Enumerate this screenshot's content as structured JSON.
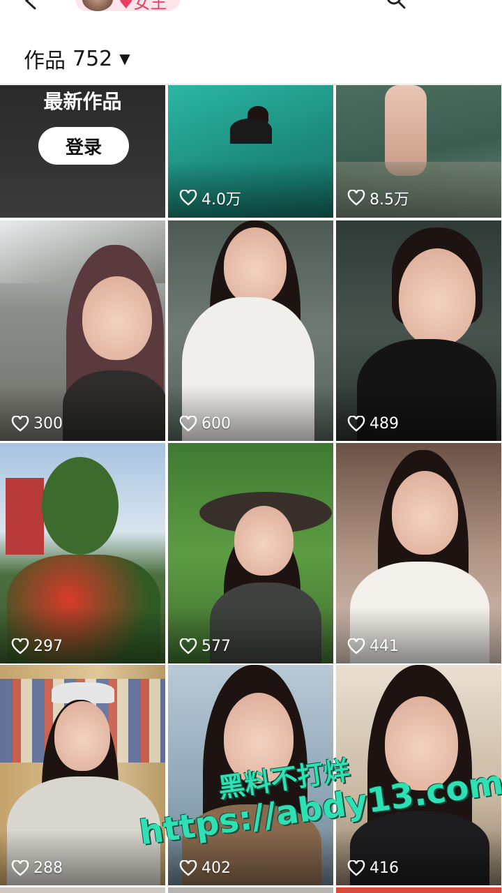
{
  "header": {
    "back_icon": "back-arrow-icon",
    "search_icon": "search-icon",
    "profile_pill_text": "♥女王",
    "works_label": "作品",
    "works_count": "752",
    "works_caret": "▼"
  },
  "login_tile": {
    "title": "最新作品",
    "button_label": "登录"
  },
  "videos": [
    {
      "likes": "4.0万"
    },
    {
      "likes": "8.5万"
    },
    {
      "likes": "300"
    },
    {
      "likes": "600"
    },
    {
      "likes": "489"
    },
    {
      "likes": "297"
    },
    {
      "likes": "577"
    },
    {
      "likes": "441"
    },
    {
      "likes": "288"
    },
    {
      "likes": "402"
    },
    {
      "likes": "416"
    }
  ],
  "watermark": {
    "line1": "黑料不打烊",
    "line2": "https://abdy13.com"
  },
  "colors": {
    "watermark": "#2fe0b4",
    "pill_text": "#e83e62"
  }
}
